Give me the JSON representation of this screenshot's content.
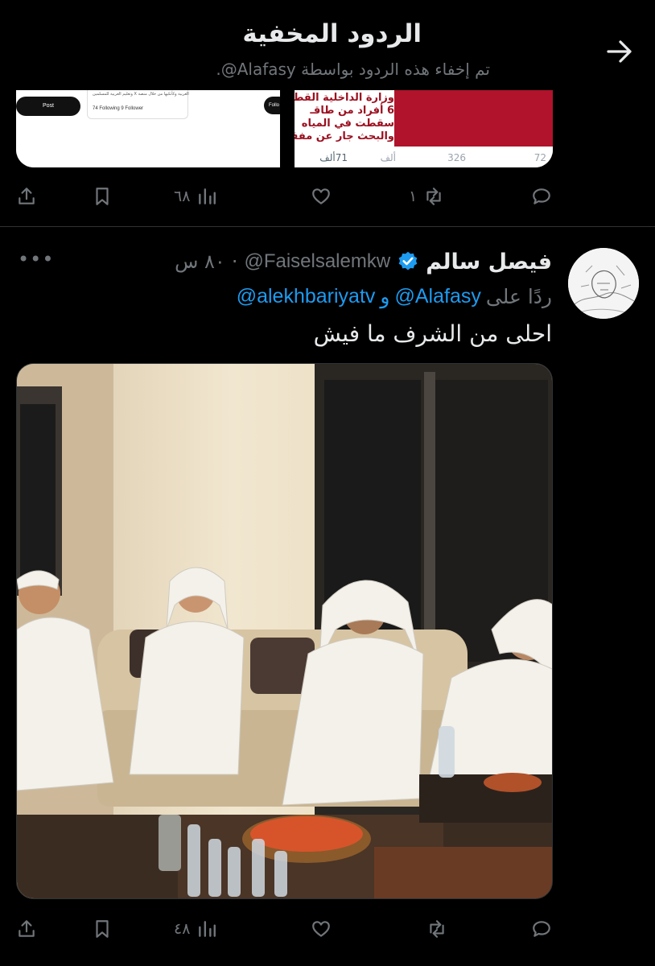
{
  "header": {
    "title": "الردود المخفية",
    "subtitle": "تم إخفاء هذه الردود بواسطة ‎@Alafasy."
  },
  "previous_tweet": {
    "media": {
      "left": {
        "post_button": "Post",
        "card_text": "العربية وكأنكيها من خلال منصة X وتعليم العربية للمسلمين",
        "card_stats": "74 Following   9 Follower",
        "follow_button": "Follo"
      },
      "right": {
        "headline_lines": [
          "وزارة الداخلية القطر",
          "6 أفراد من طاقـ",
          "سقطت في المياه",
          "والبحث جار عن مفقو"
        ],
        "stats": {
          "views": "71ألف",
          "likes": "ألف",
          "retweets": "326",
          "replies": "72"
        }
      }
    },
    "actions": {
      "views": "٦٨",
      "retweets": "١",
      "likes": "",
      "replies": ""
    }
  },
  "tweet": {
    "display_name": "فيصل سالم",
    "handle": "@Faiselsalemkw",
    "separator": "·",
    "time": "٨٠ س",
    "reply_label": "ردًا على",
    "mentions": [
      "@Alafasy",
      "@alekhbariyatv"
    ],
    "mention_joiner": "و",
    "text": "احلى من الشرف ما فيش",
    "more": "•••",
    "actions": {
      "views": "٤٨",
      "retweets": "",
      "likes": "",
      "replies": ""
    }
  },
  "icons": {
    "back": "arrow-right-icon",
    "share": "share-icon",
    "bookmark": "bookmark-icon",
    "views": "views-chart-icon",
    "like": "heart-icon",
    "retweet": "retweet-icon",
    "reply": "reply-icon",
    "verified": "verified-badge-icon"
  },
  "colors": {
    "background": "#000000",
    "text": "#e7e9ea",
    "muted": "#71767b",
    "accent": "#1d9bf0",
    "separator": "#2f3336"
  }
}
